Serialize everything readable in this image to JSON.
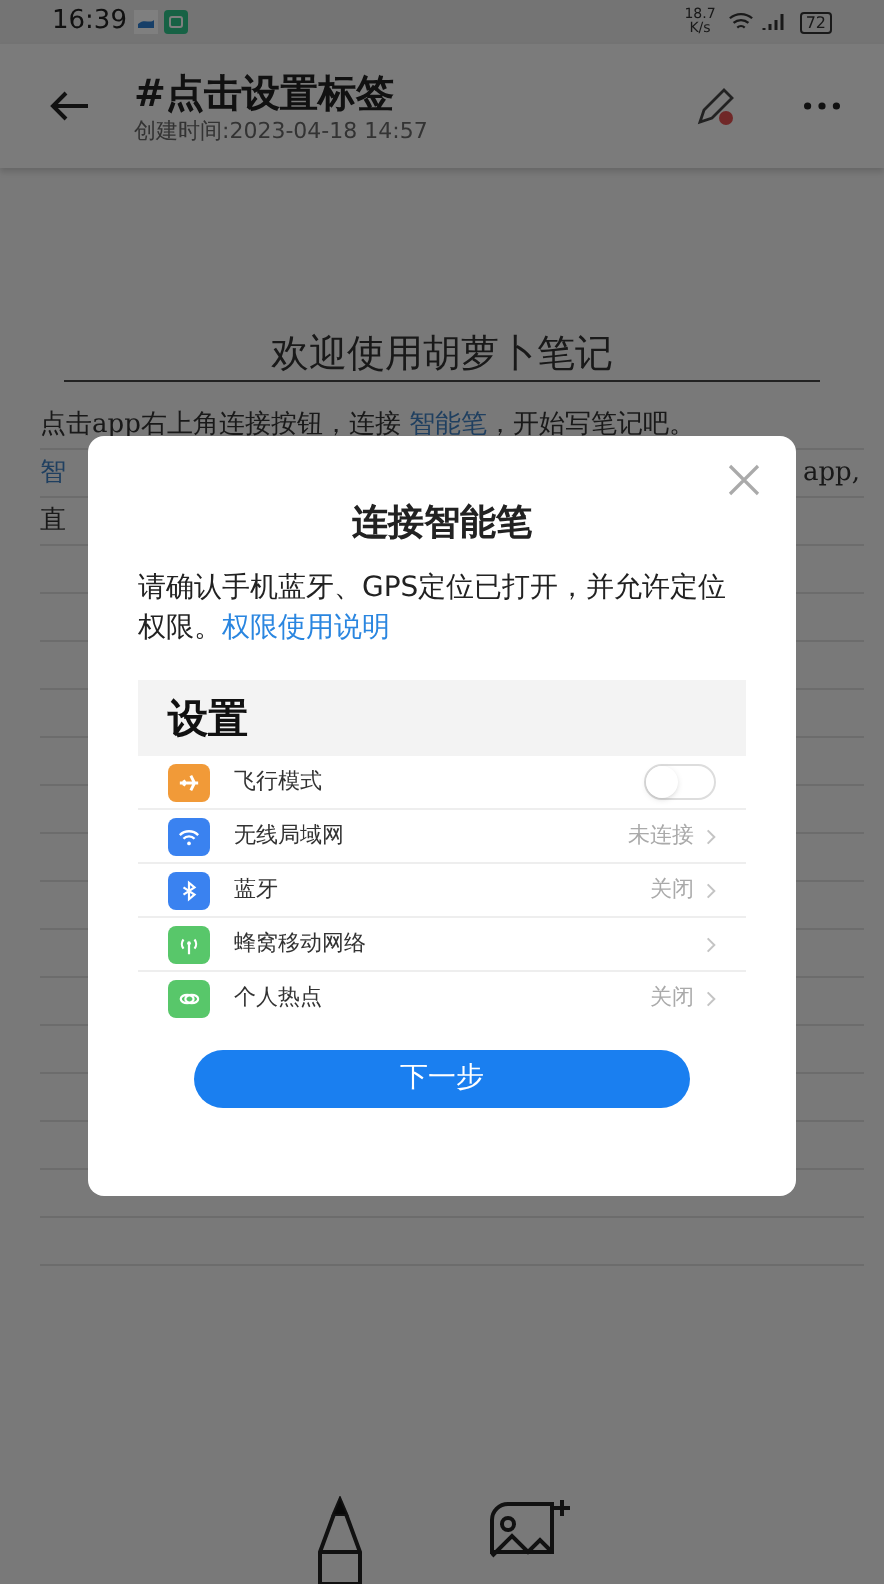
{
  "status_bar": {
    "time": "16:39",
    "speed": "18.7",
    "speed_unit": "K/s",
    "battery": "72"
  },
  "header": {
    "title": "#点击设置标签",
    "subtitle": "创建时间:2023-04-18 14:57"
  },
  "note": {
    "title": "欢迎使用胡萝卜笔记",
    "lines": [
      {
        "segments": [
          {
            "text": "点击app右上角连接按钮，连接 ",
            "kind": "plain"
          },
          {
            "text": "智能笔",
            "kind": "link"
          },
          {
            "text": "，开始写笔记吧。",
            "kind": "plain"
          }
        ]
      },
      {
        "segments": [
          {
            "text": "智",
            "kind": "link"
          }
        ],
        "end": "app,"
      },
      {
        "segments": [
          {
            "text": "直",
            "kind": "plain"
          }
        ]
      }
    ]
  },
  "dialog": {
    "title": "连接智能笔",
    "message": "请确认手机蓝牙、GPS定位已打开，并允许定位权限。",
    "link": "权限使用说明",
    "settings": {
      "heading": "设置",
      "rows": [
        {
          "kind": "toggle",
          "label": "飞行模式",
          "color": "#f19a38",
          "on": false
        },
        {
          "kind": "value",
          "label": "无线局域网",
          "color": "#3a82f0",
          "value": "未连接"
        },
        {
          "kind": "value",
          "label": "蓝牙",
          "color": "#3a82f0",
          "value": "关闭"
        },
        {
          "kind": "value",
          "label": "蜂窝移动网络",
          "color": "#58c76a"
        },
        {
          "kind": "value",
          "label": "个人热点",
          "color": "#58c76a",
          "value": "关闭"
        }
      ]
    },
    "button": "下一步"
  }
}
